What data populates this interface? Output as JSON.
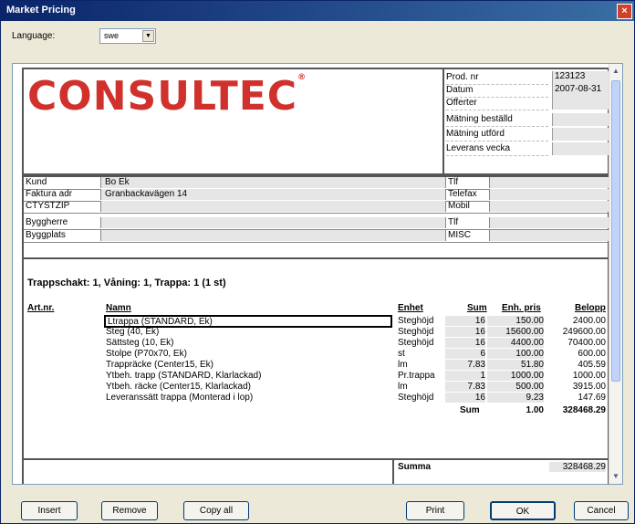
{
  "window": {
    "title": "Market Pricing",
    "close_glyph": "×"
  },
  "language": {
    "label": "Language:",
    "value": "swe",
    "arrow": "▼"
  },
  "header": {
    "logo_text": "CONSULTEC",
    "logo_mark": "®",
    "info": [
      {
        "key": "Prod. nr",
        "value": "123123"
      },
      {
        "key": "Datum",
        "value": "2007-08-31"
      },
      {
        "key": "Offerter",
        "value": ""
      },
      {
        "key": "Mätning beställd",
        "value": ""
      },
      {
        "key": "Mätning utförd",
        "value": ""
      },
      {
        "key": "Leverans vecka",
        "value": ""
      }
    ]
  },
  "customer": [
    {
      "key": "Kund",
      "value": "Bo Ek",
      "key2": "Tlf"
    },
    {
      "key": "Faktura adr",
      "value": "Granbackavägen 14",
      "key2": "Telefax"
    },
    {
      "key": "CTYSTZIP",
      "value": "",
      "key2": "Mobil"
    },
    {
      "key": "Byggherre",
      "value": "",
      "key2": "Tlf"
    },
    {
      "key": "Byggplats",
      "value": "",
      "key2": "MISC"
    }
  ],
  "section_title": "Trappschakt: 1, Våning: 1, Trappa: 1 (1 st)",
  "table": {
    "headers": {
      "art": "Art.nr.",
      "name": "Namn",
      "unit": "Enhet",
      "sum": "Sum",
      "unit_price": "Enh. pris",
      "amount": "Belopp"
    },
    "rows": [
      {
        "name": "Ltrappa (STANDARD, Ek)",
        "unit": "Steghöjd",
        "sum": "16",
        "unit_price": "150.00",
        "amount": "2400.00"
      },
      {
        "name": "Steg (40, Ek)",
        "unit": "Steghöjd",
        "sum": "16",
        "unit_price": "15600.00",
        "amount": "249600.00"
      },
      {
        "name": "Sättsteg (10, Ek)",
        "unit": "Steghöjd",
        "sum": "16",
        "unit_price": "4400.00",
        "amount": "70400.00"
      },
      {
        "name": "Stolpe (P70x70, Ek)",
        "unit": "st",
        "sum": "6",
        "unit_price": "100.00",
        "amount": "600.00"
      },
      {
        "name": "Trappräcke (Center15, Ek)",
        "unit": "lm",
        "sum": "7.83",
        "unit_price": "51.80",
        "amount": "405.59"
      },
      {
        "name": "Ytbeh. trapp (STANDARD, Klarlackad)",
        "unit": "Pr.trappa",
        "sum": "1",
        "unit_price": "1000.00",
        "amount": "1000.00"
      },
      {
        "name": "Ytbeh. räcke (Center15, Klarlackad)",
        "unit": "lm",
        "sum": "7.83",
        "unit_price": "500.00",
        "amount": "3915.00"
      },
      {
        "name": "Leveranssätt trappa (Monterad i lop)",
        "unit": "Steghöjd",
        "sum": "16",
        "unit_price": "9.23",
        "amount": "147.69"
      }
    ],
    "total": {
      "label": "Sum",
      "unit_price": "1.00",
      "amount": "328468.29"
    }
  },
  "summary": {
    "label": "Summa",
    "value": "328468.29"
  },
  "buttons": {
    "insert": "Insert",
    "remove": "Remove",
    "copy_all": "Copy all",
    "print": "Print",
    "ok": "OK",
    "cancel": "Cancel"
  }
}
